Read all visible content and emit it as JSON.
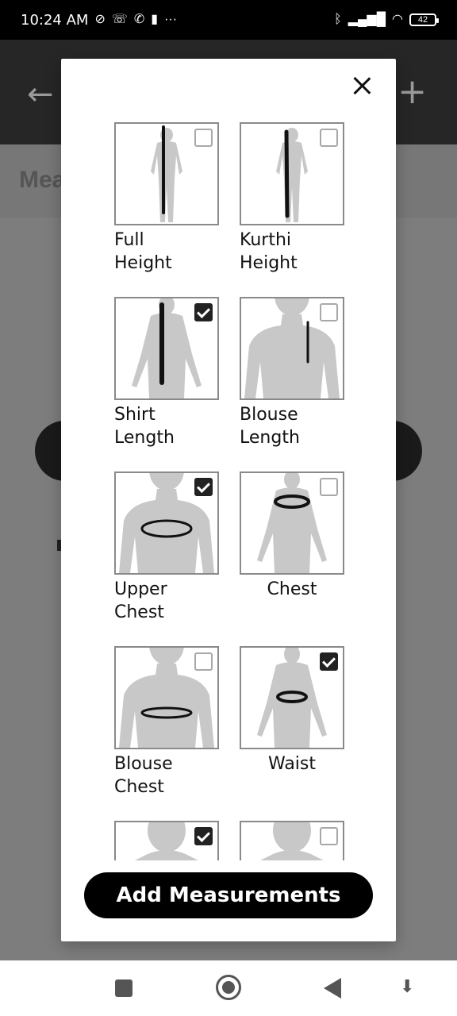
{
  "status_bar": {
    "time": "10:24 AM",
    "battery": "42",
    "icons": [
      "mute-icon",
      "missed-call-icon",
      "call-icon",
      "delete-icon",
      "more-icon",
      "bluetooth-icon",
      "signal-icon",
      "wifi-icon",
      "battery-icon"
    ]
  },
  "background": {
    "back_icon": "←",
    "add_icon": "+",
    "subtitle": "Mea"
  },
  "modal": {
    "close_icon": "close-icon",
    "add_button": "Add Measurements",
    "items": [
      {
        "line1": "Full",
        "line2": "Height",
        "checked": false,
        "figure": "full-body",
        "marker": "full-height"
      },
      {
        "line1": "Kurthi",
        "line2": "Height",
        "checked": false,
        "figure": "full-body",
        "marker": "kurthi-height"
      },
      {
        "line1": "Shirt",
        "line2": "Length",
        "checked": true,
        "figure": "torso",
        "marker": "shirt-length"
      },
      {
        "line1": "Blouse",
        "line2": "Length",
        "checked": false,
        "figure": "upper-body",
        "marker": "blouse-length"
      },
      {
        "line1": "Upper",
        "line2": "Chest",
        "checked": true,
        "figure": "upper-body",
        "marker": "upper-chest"
      },
      {
        "line1": "Chest",
        "line2": "",
        "checked": false,
        "figure": "torso",
        "marker": "chest"
      },
      {
        "line1": "Blouse",
        "line2": "Chest",
        "checked": false,
        "figure": "upper-body",
        "marker": "blouse-chest"
      },
      {
        "line1": "Waist",
        "line2": "",
        "checked": true,
        "figure": "torso",
        "marker": "waist"
      },
      {
        "line1": "",
        "line2": "",
        "checked": true,
        "figure": "head",
        "marker": "none"
      },
      {
        "line1": "",
        "line2": "",
        "checked": false,
        "figure": "head",
        "marker": "none"
      }
    ]
  },
  "colors": {
    "modal_bg": "#ffffff",
    "button_bg": "#000000",
    "checkbox_checked": "#222222",
    "figure": "#c8c8c8"
  }
}
